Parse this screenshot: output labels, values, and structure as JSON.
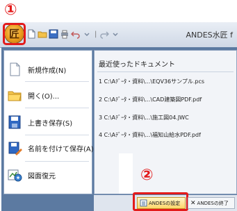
{
  "annotations": {
    "step1": "①",
    "step2": "②"
  },
  "window": {
    "title": "ANDES水匠 f"
  },
  "app_button": {
    "glyph": "匠",
    "icon": "app-logo-icon"
  },
  "quick_access": {
    "separator": "|"
  },
  "menu": {
    "items": [
      {
        "label": "新規作成(N)",
        "icon": "new-document-icon"
      },
      {
        "label": "開く(O)...",
        "icon": "folder-open-icon"
      },
      {
        "label": "上書き保存(S)",
        "icon": "save-icon"
      },
      {
        "label": "名前を付けて保存(A)...",
        "icon": "save-as-icon",
        "arrow": "▸"
      },
      {
        "label": "図面復元",
        "icon": "restore-drawing-icon"
      }
    ]
  },
  "recent": {
    "title": "最近使ったドキュメント",
    "items": [
      "1 C:\\Aﾃﾞｰﾀ・資料\\...\\EQV36サンプル.pcs",
      "2 C:\\Aﾃﾞｰﾀ・資料\\...\\CAD建築図PDF.pdf",
      "3 C:\\Aﾃﾞｰﾀ・資料\\...\\施工図04.JWC",
      "4 C:\\Aﾃﾞｰﾀ・資料\\...\\福知山給水PDF.pdf"
    ]
  },
  "bottom": {
    "settings_label": "ANDESの設定",
    "exit_label": "ANDESの終了",
    "exit_glyph": "✕"
  },
  "colors": {
    "annotation": "#e31b1b",
    "menu_frame": "#5c7aa1",
    "settings_button": "#ffd76a"
  }
}
